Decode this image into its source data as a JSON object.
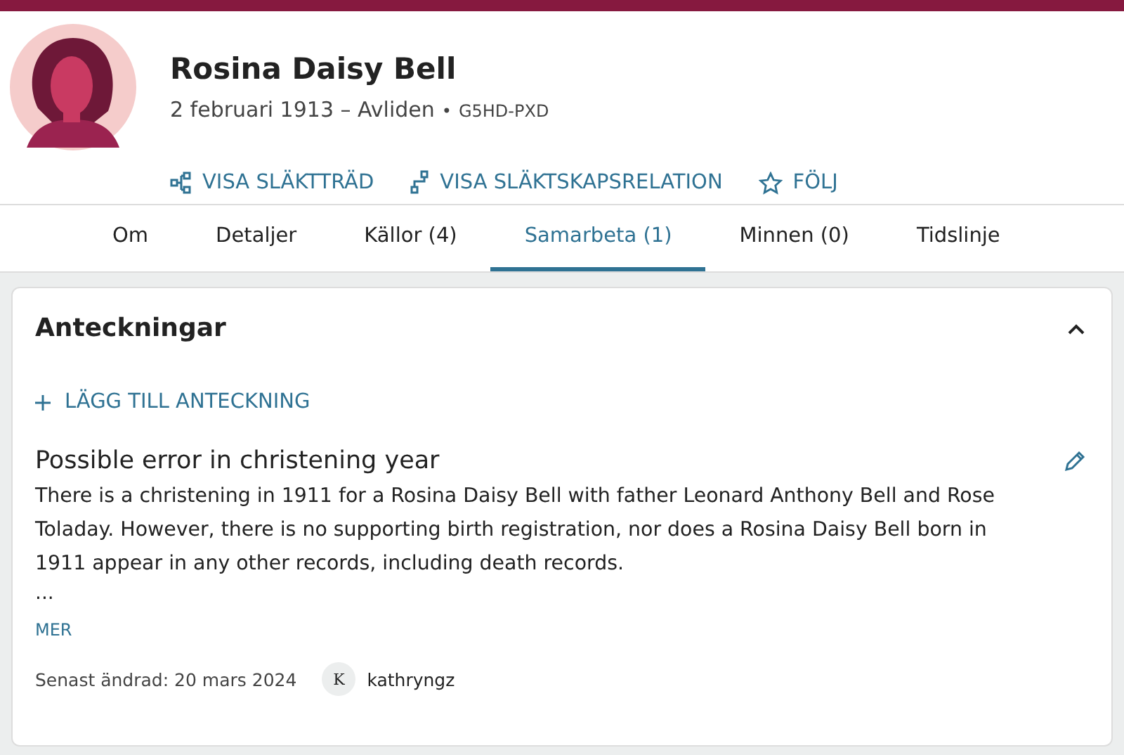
{
  "person": {
    "name": "Rosina Daisy Bell",
    "dates": "2 februari 1913 – Avliden",
    "separator": "•",
    "id": "G5HD-PXD"
  },
  "actions": [
    {
      "kind": "tree",
      "label": "VISA SLÄKTTRÄD"
    },
    {
      "kind": "relation",
      "label": "VISA SLÄKTSKAPSRELATION"
    },
    {
      "kind": "follow",
      "label": "FÖLJ"
    }
  ],
  "tabs": [
    {
      "label": "Om",
      "selected": false
    },
    {
      "label": "Detaljer",
      "selected": false
    },
    {
      "label": "Källor (4)",
      "selected": false
    },
    {
      "label": "Samarbeta (1)",
      "selected": true
    },
    {
      "label": "Minnen (0)",
      "selected": false
    },
    {
      "label": "Tidslinje",
      "selected": false
    }
  ],
  "notes_panel": {
    "title": "Anteckningar",
    "expanded": true,
    "add_label": "LÄGG TILL ANTECKNING",
    "note": {
      "title": "Possible error in christening year",
      "body": "There is a christening in 1911 for a Rosina Daisy Bell with father Leonard Anthony Bell and Rose Toladay. However, there is no supporting birth registration, nor does a Rosina Daisy Bell born in 1911 appear in any other records, including death records.",
      "ellipsis": "...",
      "more": "MER",
      "modified": "Senast ändrad: 20 mars 2024",
      "author_initial": "K",
      "author": "kathryngz"
    }
  }
}
